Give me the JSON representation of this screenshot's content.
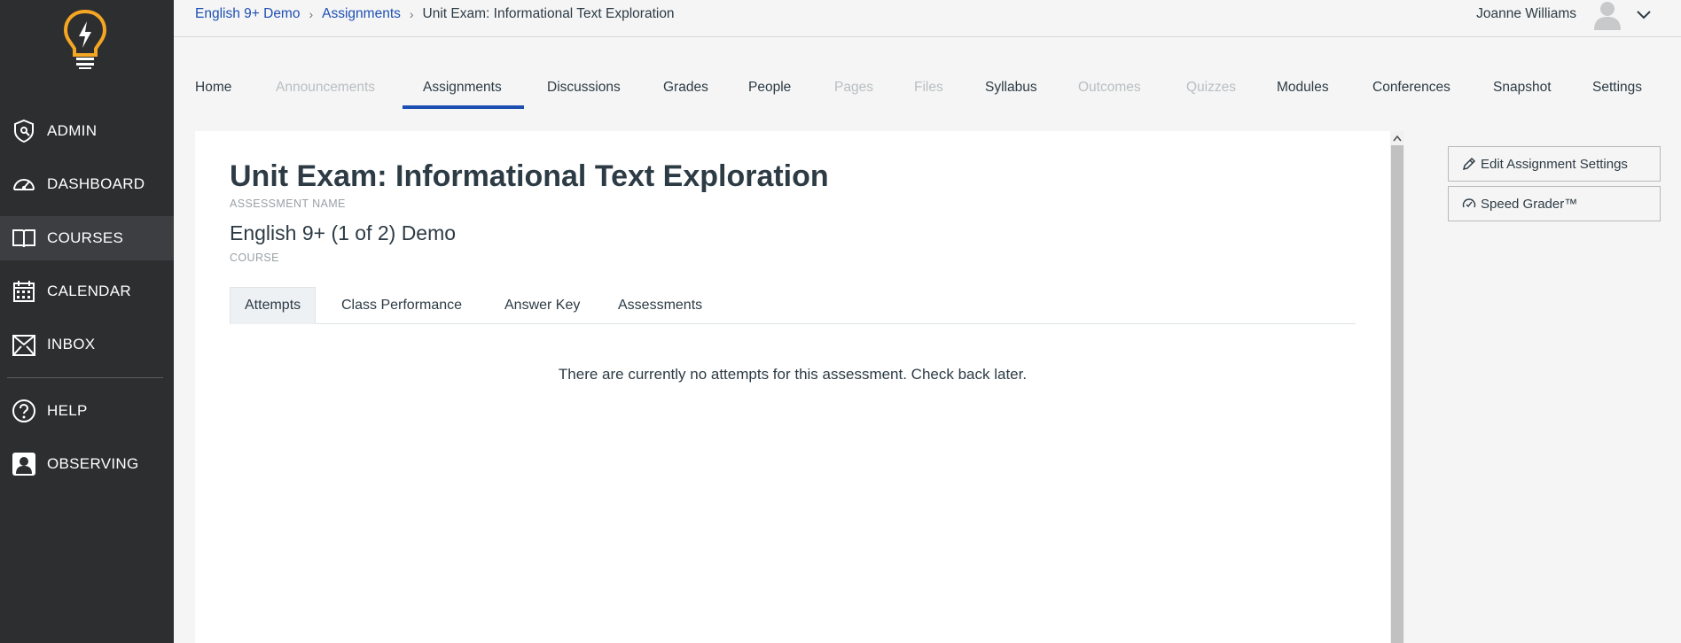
{
  "sidebar": {
    "items": [
      {
        "label": "ADMIN",
        "icon": "admin-shield-icon"
      },
      {
        "label": "DASHBOARD",
        "icon": "dashboard-gauge-icon"
      },
      {
        "label": "COURSES",
        "icon": "book-icon",
        "active": true
      },
      {
        "label": "CALENDAR",
        "icon": "calendar-icon"
      },
      {
        "label": "INBOX",
        "icon": "inbox-icon"
      },
      {
        "label": "HELP",
        "icon": "help-question-icon"
      },
      {
        "label": "OBSERVING",
        "icon": "observing-user-icon"
      }
    ],
    "logo_color": "#f5a623"
  },
  "header": {
    "breadcrumb": [
      "English 9+ Demo",
      "Assignments",
      "Unit Exam: Informational Text Exploration"
    ],
    "user_name": "Joanne Williams"
  },
  "course_nav": {
    "tabs": [
      {
        "label": "Home",
        "enabled": true
      },
      {
        "label": "Announcements",
        "enabled": false
      },
      {
        "label": "Assignments",
        "enabled": true,
        "active": true
      },
      {
        "label": "Discussions",
        "enabled": true
      },
      {
        "label": "Grades",
        "enabled": true
      },
      {
        "label": "People",
        "enabled": true
      },
      {
        "label": "Pages",
        "enabled": false
      },
      {
        "label": "Files",
        "enabled": false
      },
      {
        "label": "Syllabus",
        "enabled": true
      },
      {
        "label": "Outcomes",
        "enabled": false
      },
      {
        "label": "Quizzes",
        "enabled": false
      },
      {
        "label": "Modules",
        "enabled": true
      },
      {
        "label": "Conferences",
        "enabled": true
      },
      {
        "label": "Snapshot",
        "enabled": true
      },
      {
        "label": "Settings",
        "enabled": true
      }
    ],
    "accent_color": "#1d4fb3"
  },
  "main": {
    "title": "Unit Exam: Informational Text Exploration",
    "title_label": "ASSESSMENT NAME",
    "course_name": "English 9+ (1 of 2) Demo",
    "course_label": "COURSE",
    "tabs": [
      {
        "label": "Attempts",
        "active": true
      },
      {
        "label": "Class Performance"
      },
      {
        "label": "Answer Key"
      },
      {
        "label": "Assessments"
      }
    ],
    "empty_message": "There are currently no attempts for this assessment. Check back later."
  },
  "actions": {
    "edit_settings": "Edit Assignment Settings",
    "speed_grader": "Speed Grader™"
  }
}
